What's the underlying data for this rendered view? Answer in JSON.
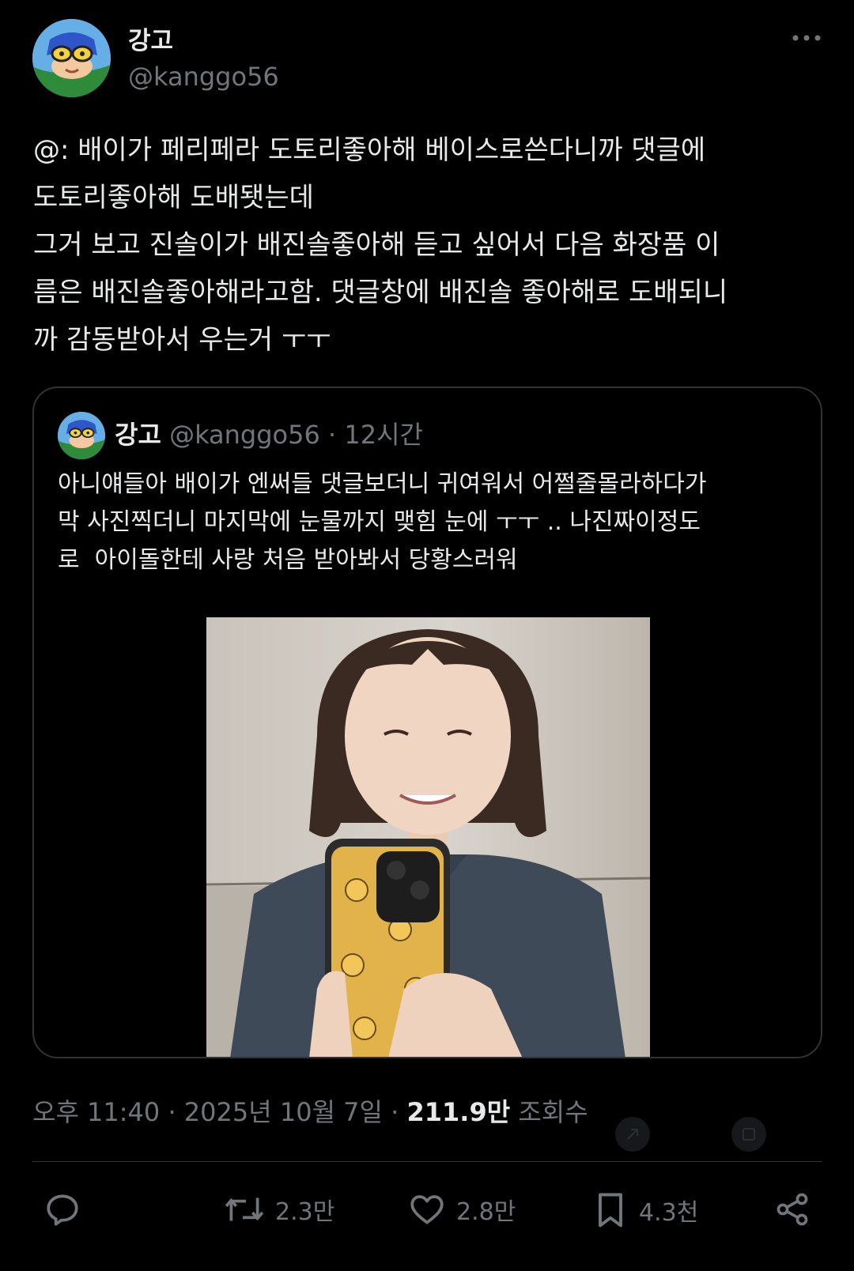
{
  "author": {
    "name": "강고",
    "handle": "@kanggo56"
  },
  "tweet": {
    "text": "@: 배이가 페리페라 도토리좋아해 베이스로쓴다니까 댓글에\n도토리좋아해 도배됏는데\n그거 보고 진솔이가 배진솔좋아해 듣고 싶어서 다음 화장품 이\n름은 배진솔좋아해라고함. 댓글창에 배진솔 좋아해로 도배되니\n까 감동받아서 우는거 ㅜㅜ"
  },
  "quote": {
    "name": "강고",
    "handle": "@kanggo56",
    "separator": "·",
    "time": "12시간",
    "text": "아니얘들아 배이가 엔써들 댓글보더니 귀여워서 어쩔줄몰라하다가\n막 사진찍더니 마지막에 눈물까지 맺힘 눈에 ㅜㅜ .. 나진짜이정도\n로  아이돌한테 사랑 처음 받아봐서 당황스러워"
  },
  "meta": {
    "time": "오후 11:40",
    "date": "2025년 10월 7일",
    "separator": "·",
    "views_count": "211.9만",
    "views_label": "조회수"
  },
  "actions": {
    "retweets": "2.3만",
    "likes": "2.8만",
    "bookmarks": "4.3천"
  },
  "colors": {
    "background": "#000000",
    "text_primary": "#e7e9ea",
    "text_secondary": "#71767b",
    "border": "#2f3336"
  }
}
